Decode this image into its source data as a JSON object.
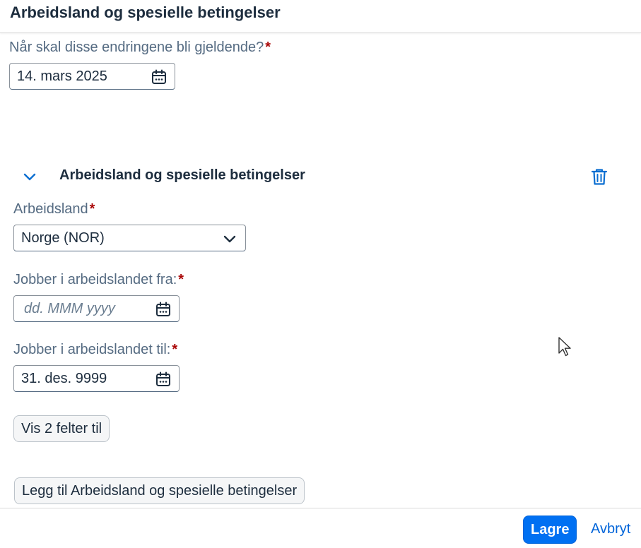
{
  "header": {
    "title": "Arbeidsland og spesielle betingelser"
  },
  "effective_date": {
    "label": "Når skal disse endringene bli gjeldende?",
    "required_mark": "*",
    "value": "14. mars 2025",
    "icon": "calendar-icon"
  },
  "section": {
    "title": "Arbeidsland og spesielle betingelser",
    "expand_icon": "chevron-down-icon",
    "delete_icon": "trash-icon",
    "country": {
      "label": "Arbeidsland",
      "required_mark": "*",
      "value": "Norge (NOR)",
      "icon": "chevron-down-icon"
    },
    "from_date": {
      "label": "Jobber i arbeidslandet fra:",
      "required_mark": "*",
      "placeholder": "dd. MMM yyyy",
      "icon": "calendar-icon"
    },
    "to_date": {
      "label": "Jobber i arbeidslandet til:",
      "required_mark": "*",
      "value": "31. des. 9999",
      "icon": "calendar-icon"
    },
    "show_more_label": "Vis 2 felter til"
  },
  "add_button_label": "Legg til Arbeidsland og spesielle betingelser",
  "footer": {
    "save_label": "Lagre",
    "cancel_label": "Avbryt"
  },
  "colors": {
    "primary": "#0070f2",
    "required": "#aa0808",
    "text": "#1d2d3e",
    "label": "#556b82"
  }
}
